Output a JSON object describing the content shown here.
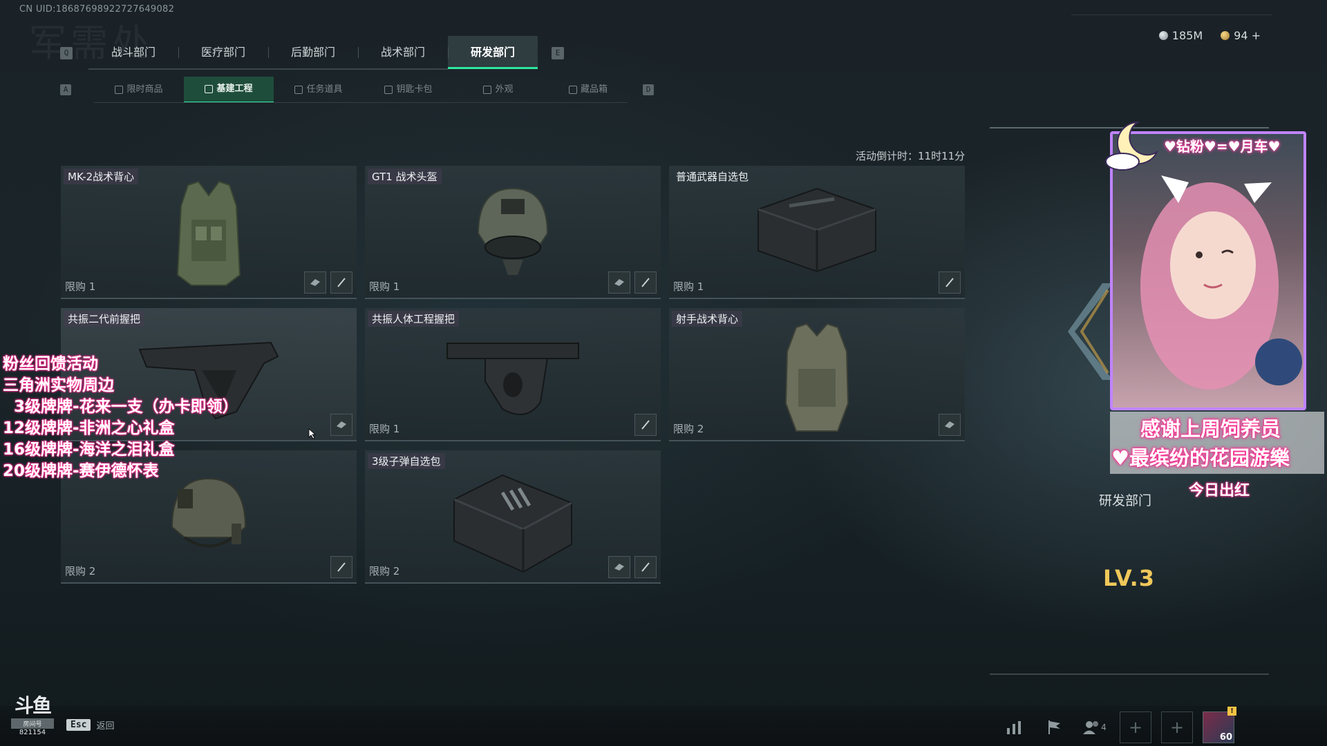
{
  "header": {
    "uid": "CN UID:18687698922727649082",
    "ghost_title": "军需处",
    "key_prev": "Q",
    "key_next": "E",
    "dept_tabs": [
      {
        "label": "战斗部门"
      },
      {
        "label": "医疗部门"
      },
      {
        "label": "后勤部门"
      },
      {
        "label": "战术部门"
      },
      {
        "label": "研发部门",
        "active": true
      }
    ],
    "subkey_prev": "A",
    "subkey_next": "D",
    "sub_tabs": [
      {
        "label": "限时商品"
      },
      {
        "label": "基建工程",
        "active": true
      },
      {
        "label": "任务道具"
      },
      {
        "label": "钥匙卡包"
      },
      {
        "label": "外观"
      },
      {
        "label": "藏品箱"
      }
    ],
    "currency": [
      {
        "icon": "silver-coin-icon",
        "value": "185M"
      },
      {
        "icon": "gold-coin-icon",
        "value": "94 +"
      }
    ]
  },
  "countdown": "活动倒计时：11时11分",
  "items": [
    {
      "name": "MK-2战术背心",
      "limit": "限购 1",
      "icons": [
        "exchange-icon",
        "blueprint-icon"
      ]
    },
    {
      "name": "GT1 战术头盔",
      "limit": "限购 1",
      "icons": [
        "exchange-icon",
        "blueprint-icon"
      ]
    },
    {
      "name": "普通武器自选包",
      "limit": "限购 1",
      "icons": [
        "blueprint-icon"
      ]
    },
    {
      "name": "共振二代前握把",
      "limit": "",
      "icons": [
        "exchange-icon"
      ]
    },
    {
      "name": "共振人体工程握把",
      "limit": "限购 1",
      "icons": [
        "blueprint-icon"
      ]
    },
    {
      "name": "射手战术背心",
      "limit": "限购 2",
      "icons": [
        "exchange-icon"
      ]
    },
    {
      "name": "",
      "limit": "限购 2",
      "icons": [
        "blueprint-icon"
      ]
    },
    {
      "name": "3级子弹自选包",
      "limit": "限购 2",
      "icons": [
        "exchange-icon",
        "blueprint-icon"
      ]
    }
  ],
  "right_panel": {
    "dept_label": "研发部门",
    "level": "LV.3"
  },
  "overlay": {
    "webcam_banner": "♥钻粉♥=♥月车♥",
    "thanks_line1": "感谢上周饲养员",
    "thanks_line2": "♥最缤纷的花园游樂",
    "today_red": "今日出红",
    "promo": [
      "粉丝回馈活动",
      "三角洲实物周边",
      "  3级牌牌-花来一支（办卡即领）",
      "12级牌牌-非洲之心礼盒",
      "16级牌牌-海洋之泪礼盒",
      "20级牌牌-赛伊德怀表"
    ],
    "douyu_logo": "斗鱼",
    "douyu_room_label": "房间号",
    "douyu_room": "821154"
  },
  "footer": {
    "esc_key": "Esc",
    "esc_label": "返回",
    "squad_count": "4",
    "player_level": "60",
    "alert": "!"
  },
  "colors": {
    "accent": "#2ee6a0",
    "level": "#f0c85a",
    "overlay_pink": "#ff2b92"
  }
}
